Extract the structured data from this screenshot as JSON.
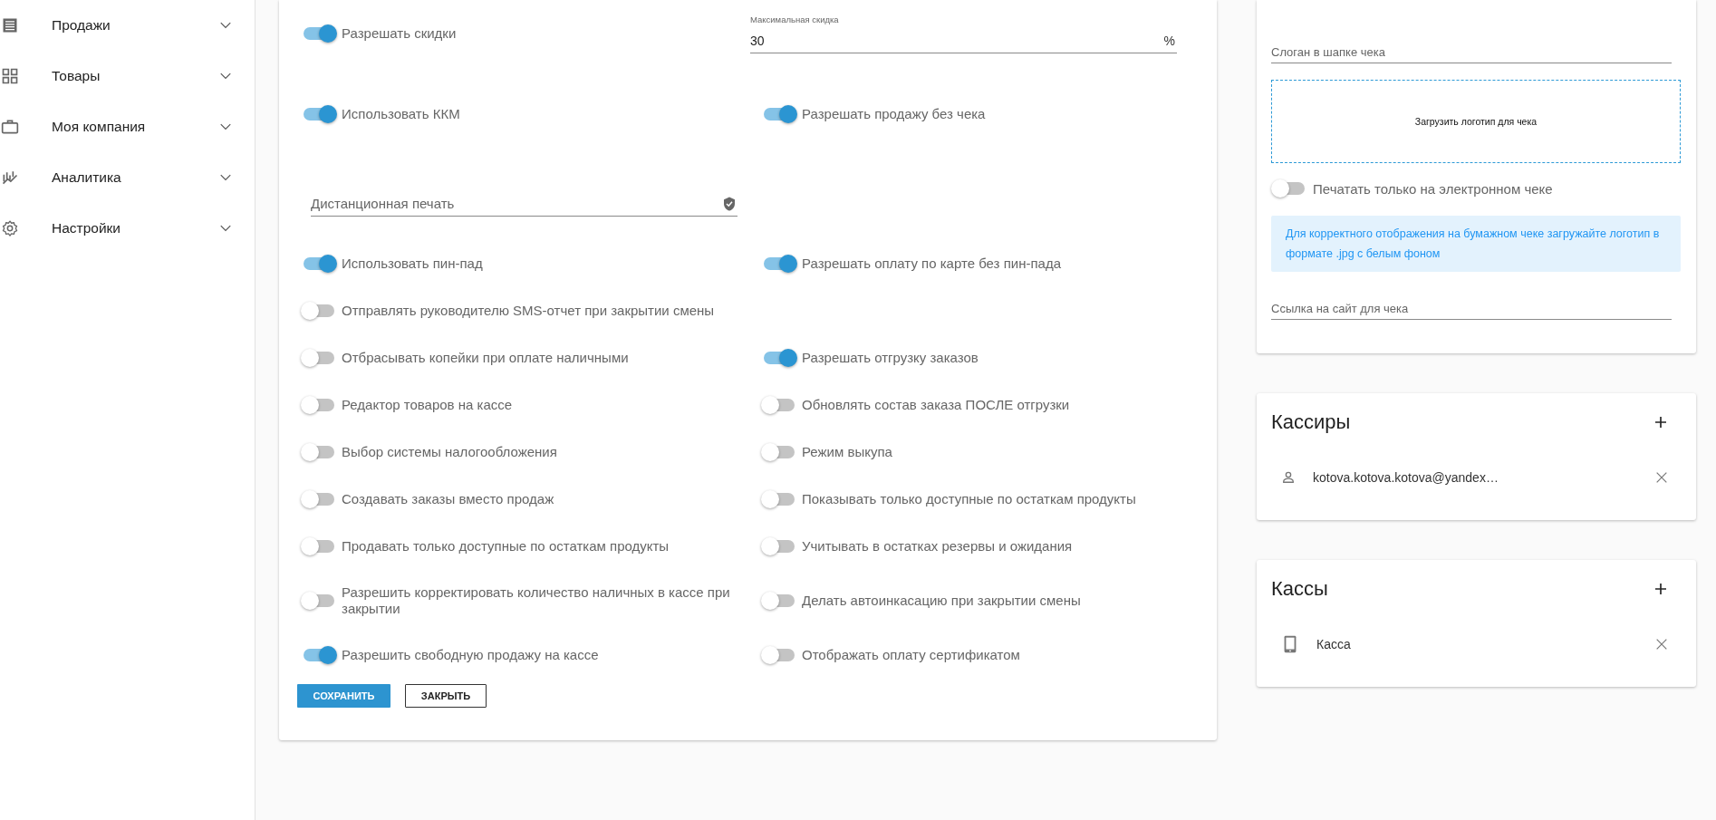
{
  "sidebar": {
    "items": [
      {
        "label": "Продажи",
        "expanded": false
      },
      {
        "label": "Товары",
        "expanded": false
      },
      {
        "label": "Моя компания",
        "expanded": false
      },
      {
        "label": "Аналитика",
        "expanded": false
      },
      {
        "label": "Настройки",
        "expanded": false
      }
    ]
  },
  "settings": {
    "rows": [
      {
        "cells": [
          {
            "kind": "toggle",
            "label": "Разрешать скидки",
            "on": true
          },
          {
            "kind": "field",
            "label": "Максимальная скидка",
            "value": "30",
            "suffix": "%"
          }
        ]
      },
      {
        "cells": [
          {
            "kind": "toggle",
            "label": "Использовать ККМ",
            "on": true
          },
          {
            "kind": "toggle",
            "label": "Разрешать продажу без чека",
            "on": true
          }
        ]
      },
      {
        "cells": [
          {
            "kind": "field",
            "placeholder": "Дистанционная печать"
          }
        ]
      },
      {
        "cells": [
          {
            "kind": "toggle",
            "label": "Использовать пин-пад",
            "on": true
          },
          {
            "kind": "toggle",
            "label": "Разрешать оплату по карте без пин-пада",
            "on": true
          }
        ]
      },
      {
        "cells": [
          {
            "kind": "toggle",
            "label": "Отправлять руководителю SMS-отчет при закрытии смены",
            "on": false
          }
        ]
      },
      {
        "cells": [
          {
            "kind": "toggle",
            "label": "Отбрасывать копейки при оплате наличными",
            "on": false
          },
          {
            "kind": "toggle",
            "label": "Разрешать отгрузку заказов",
            "on": true
          }
        ]
      },
      {
        "cells": [
          {
            "kind": "toggle",
            "label": "Редактор товаров на кассе",
            "on": false
          },
          {
            "kind": "toggle",
            "label": "Обновлять состав заказа ПОСЛЕ отгрузки",
            "on": false
          }
        ]
      },
      {
        "cells": [
          {
            "kind": "toggle",
            "label": "Выбор системы налогообложения",
            "on": false
          },
          {
            "kind": "toggle",
            "label": "Режим выкупа",
            "on": false
          }
        ]
      },
      {
        "cells": [
          {
            "kind": "toggle",
            "label": "Создавать заказы вместо продаж",
            "on": false
          },
          {
            "kind": "toggle",
            "label": "Показывать только доступные по остаткам продукты",
            "on": false
          }
        ]
      },
      {
        "cells": [
          {
            "kind": "toggle",
            "label": "Продавать только доступные по остаткам продукты",
            "on": false
          },
          {
            "kind": "toggle",
            "label": "Учитывать в остатках резервы и ожидания",
            "on": false
          }
        ]
      },
      {
        "cells": [
          {
            "kind": "toggle",
            "label": "Разрешить корректировать количество наличных в кассе при закрытии",
            "on": false
          },
          {
            "kind": "toggle",
            "label": "Делать автоинкасацию при закрытии смены",
            "on": false
          }
        ]
      },
      {
        "cells": [
          {
            "kind": "toggle",
            "label": "Разрешить свободную продажу на кассе",
            "on": true
          },
          {
            "kind": "toggle",
            "label": "Отображать оплату сертификатом",
            "on": false
          }
        ]
      }
    ],
    "buttons": [
      {
        "label": "СОХРАНИТЬ",
        "kind": "primary"
      },
      {
        "label": "ЗАКРЫТЬ",
        "kind": "outlined"
      }
    ]
  },
  "receipt": {
    "slogan": {
      "placeholder": "Слоган в шапке чека"
    },
    "upload": "Загрузить логотип для чека",
    "electronic_only": {
      "label": "Печатать только на электронном чеке",
      "on": false
    },
    "hint": "Для корректного отображения на бумажном чеке загружайте логотип в формате .jpg с белым фоном",
    "site_link": {
      "placeholder": "Ссылка на сайт для чека"
    }
  },
  "cashiers": {
    "title": "Кассиры",
    "items": [
      {
        "label": "kotova.kotova.kotova@yandex…"
      }
    ]
  },
  "registers": {
    "title": "Кассы",
    "items": [
      {
        "label": "Касса"
      }
    ]
  }
}
